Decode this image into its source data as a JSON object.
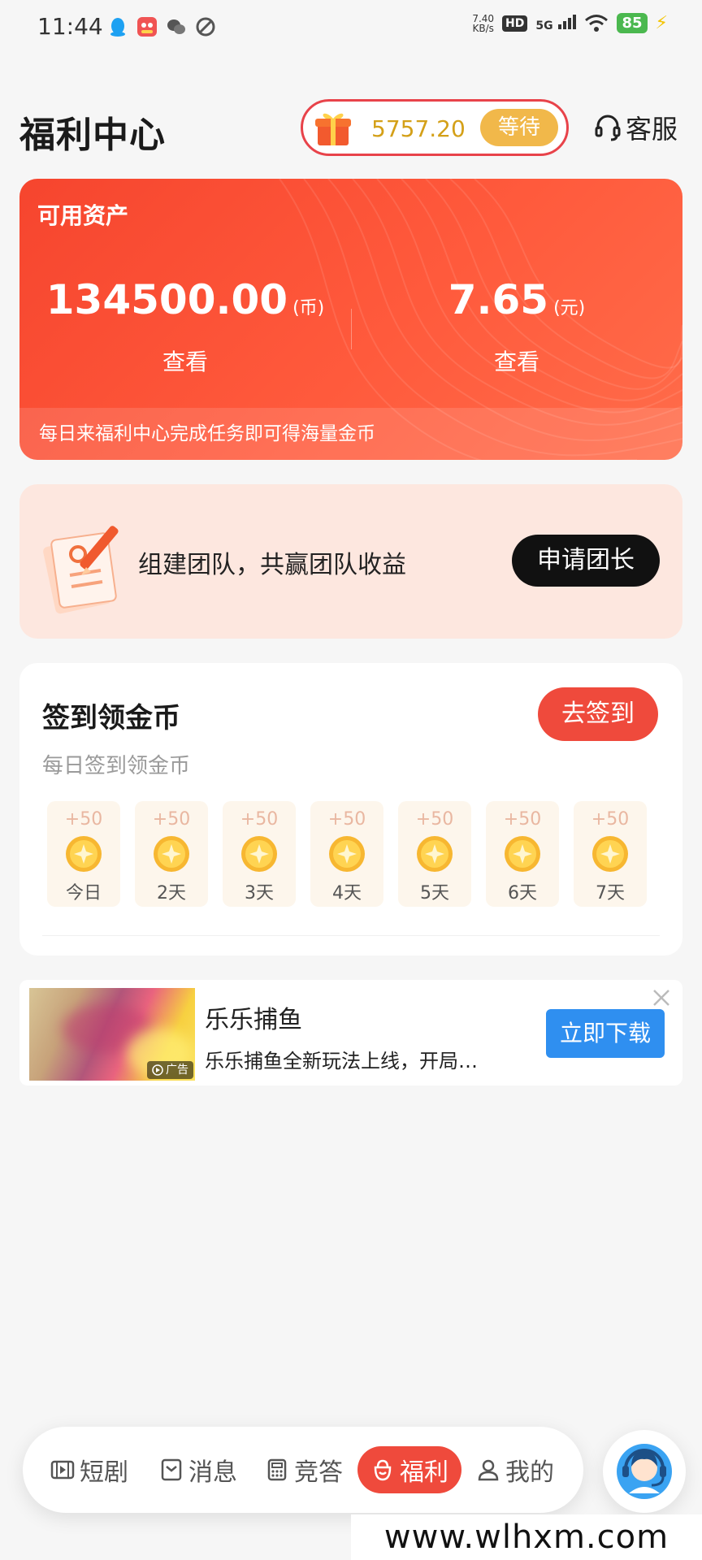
{
  "status_bar": {
    "time": "11:44",
    "net_speed_value": "7.40",
    "net_speed_unit": "KB/s",
    "hd_label": "HD",
    "network_label": "5G",
    "battery": "85"
  },
  "header": {
    "title": "福利中心",
    "gift_amount": "5757.20",
    "wait_label": "等待",
    "service_label": "客服"
  },
  "assets": {
    "label": "可用资产",
    "coins_value": "134500.00",
    "coins_unit": "(币)",
    "coins_view": "查看",
    "cash_value": "7.65",
    "cash_unit": "(元)",
    "cash_view": "查看",
    "footer": "每日来福利中心完成任务即可得海量金币"
  },
  "team": {
    "text": "组建团队，共赢团队收益",
    "button_label": "申请团长"
  },
  "signin": {
    "title": "签到领金币",
    "subtitle": "每日签到领金币",
    "button_label": "去签到",
    "days": [
      {
        "bonus": "+50",
        "label": "今日"
      },
      {
        "bonus": "+50",
        "label": "2天"
      },
      {
        "bonus": "+50",
        "label": "3天"
      },
      {
        "bonus": "+50",
        "label": "4天"
      },
      {
        "bonus": "+50",
        "label": "5天"
      },
      {
        "bonus": "+50",
        "label": "6天"
      },
      {
        "bonus": "+50",
        "label": "7天"
      }
    ]
  },
  "ad": {
    "title": "乐乐捕鱼",
    "description": "乐乐捕鱼全新玩法上线，开局…",
    "badge": "广告",
    "button_label": "立即下载"
  },
  "bottom_nav": {
    "items": [
      {
        "label": "短剧",
        "icon": "video-icon"
      },
      {
        "label": "消息",
        "icon": "message-icon"
      },
      {
        "label": "竞答",
        "icon": "quiz-icon"
      },
      {
        "label": "福利",
        "icon": "gift-bag-icon",
        "active": true
      },
      {
        "label": "我的",
        "icon": "user-icon"
      }
    ]
  },
  "watermark": "www.wlhxm.com",
  "colors": {
    "accent_red": "#ef4a3c",
    "card_orange": "#f6452e",
    "gold": "#d4a018",
    "download_blue": "#2f8ff0"
  }
}
